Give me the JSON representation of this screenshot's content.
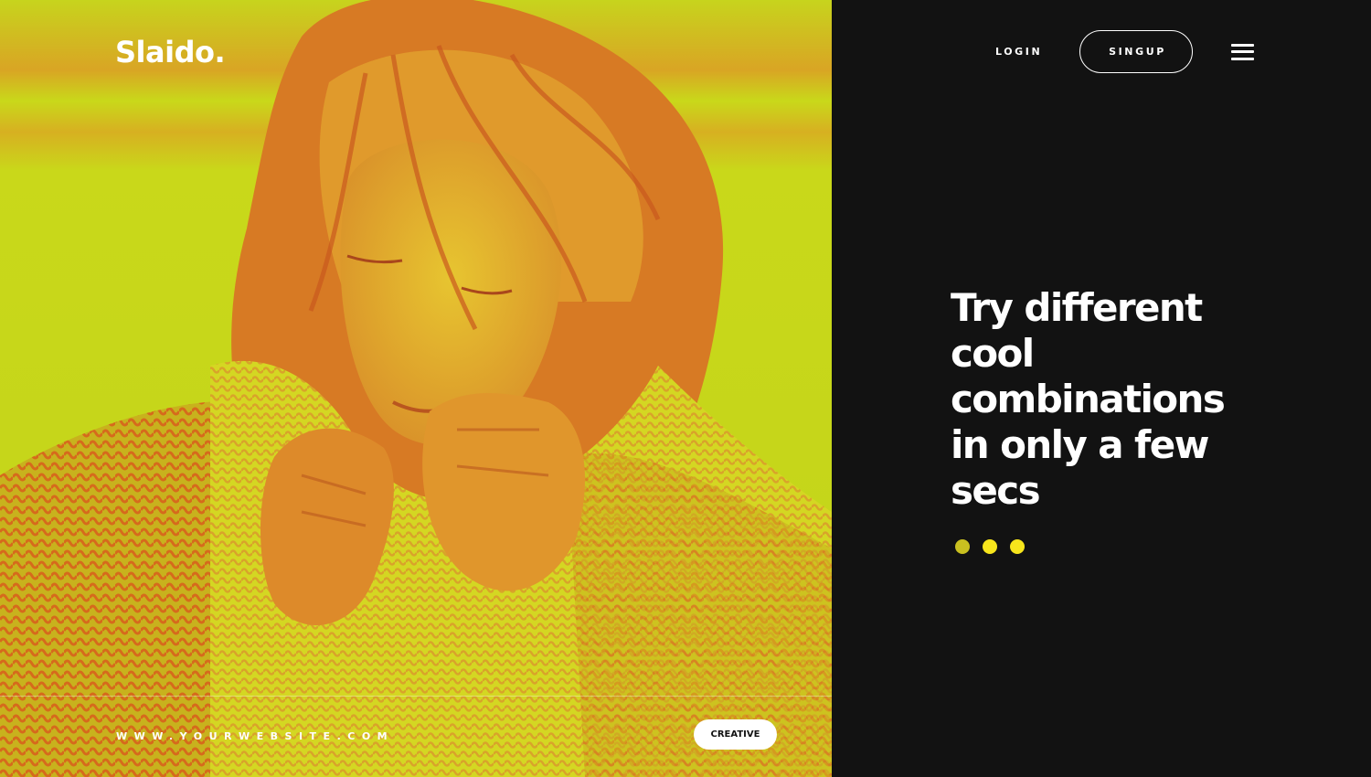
{
  "brand": {
    "logo": "Slaido."
  },
  "nav": {
    "login_label": "LOGIN",
    "signup_label": "SINGUP",
    "menu_icon": "hamburger-menu-icon"
  },
  "hero": {
    "headline": "Try different cool combinations in only a few secs",
    "slider_dots": 3,
    "active_dot": 1
  },
  "footer": {
    "website": "WWW.YOURWEBSITE.COM",
    "tag_label": "CREATIVE"
  },
  "colors": {
    "dark_bg": "#121212",
    "accent_yellow": "#f7e51c",
    "photo_yellow": "#c9d81a",
    "photo_orange": "#d4661e",
    "text": "#ffffff"
  }
}
